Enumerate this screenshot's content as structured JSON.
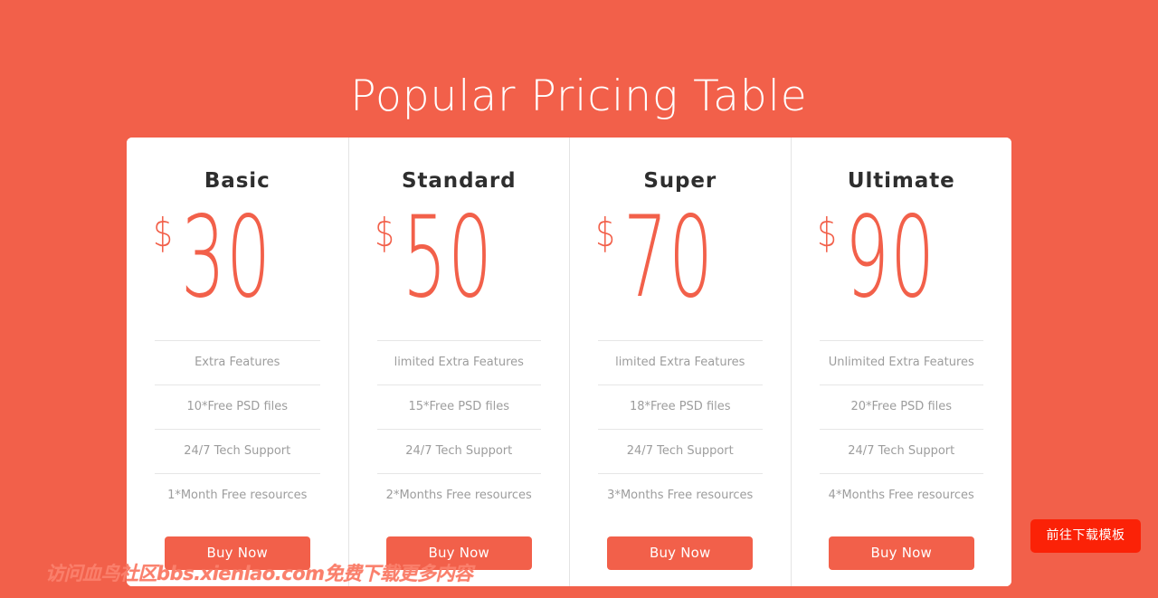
{
  "page": {
    "title": "Popular Pricing Table",
    "background_color": "#f2604a",
    "accent_color": "#f2604a",
    "card_background": "#ffffff",
    "feature_text_color": "#9d9d9d",
    "heading_color": "#2e2e2e"
  },
  "currency_symbol": "$",
  "plans": [
    {
      "name": "Basic",
      "price": "30",
      "currency": "$",
      "features": [
        "Extra Features",
        "10*Free PSD files",
        "24/7 Tech Support",
        "1*Month Free resources"
      ],
      "cta_label": "Buy Now"
    },
    {
      "name": "Standard",
      "price": "50",
      "currency": "$",
      "features": [
        "limited Extra Features",
        "15*Free PSD files",
        "24/7 Tech Support",
        "2*Months Free resources"
      ],
      "cta_label": "Buy Now"
    },
    {
      "name": "Super",
      "price": "70",
      "currency": "$",
      "features": [
        "limited Extra Features",
        "18*Free PSD files",
        "24/7 Tech Support",
        "3*Months Free resources"
      ],
      "cta_label": "Buy Now"
    },
    {
      "name": "Ultimate",
      "price": "90",
      "currency": "$",
      "features": [
        "Unlimited Extra Features",
        "20*Free PSD files",
        "24/7 Tech Support",
        "4*Months Free resources"
      ],
      "cta_label": "Buy Now"
    }
  ],
  "watermark": {
    "text": "访问血鸟社区bbs.xienlao.com免费下载更多内容",
    "color": "#fa7f6b"
  },
  "download_button": {
    "label": "前往下载模板",
    "color": "#fb2207"
  }
}
